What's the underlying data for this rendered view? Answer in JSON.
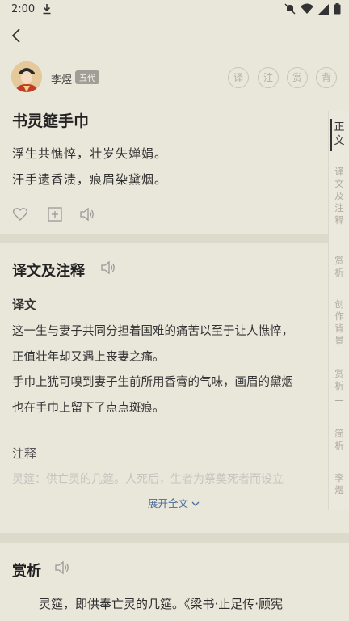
{
  "status": {
    "time": "2:00"
  },
  "author": {
    "name": "李煜",
    "dynasty": "五代"
  },
  "actions": {
    "translate": "译",
    "annotate": "注",
    "appreciate": "赏",
    "recite": "背"
  },
  "poem": {
    "title": "书灵筵手巾",
    "lines": [
      "浮生共憔悴，壮岁失婵娟。",
      "汗手遗香渍，痕眉染黛烟。"
    ]
  },
  "translation_section": {
    "title": "译文及注释",
    "translation_heading": "译文",
    "translation_lines": [
      "这一生与妻子共同分担着国难的痛苦以至于让人憔悴，",
      "正值壮年却又遇上丧妻之痛。",
      "手巾上犹可嗅到妻子生前所用香膏的气味，画眉的黛烟",
      "也在手巾上留下了点点斑痕。"
    ],
    "notes_heading": "注释",
    "notes_preview": "灵筵：供亡灵的几筵。人死后，生者为祭奠死者而设立",
    "expand_label": "展开全文"
  },
  "side_nav": {
    "items": [
      "正文",
      "译文及注释",
      "赏析",
      "创作背景",
      "赏析二",
      "简析",
      "李煜"
    ]
  },
  "appreciation_section": {
    "title": "赏析",
    "first_line": "灵筵，即供奉亡灵的几筵。《梁书·止足传·顾宪"
  },
  "colors": {
    "background": "#e9e6da",
    "band": "#dcdacb",
    "link": "#4a6a9a"
  }
}
